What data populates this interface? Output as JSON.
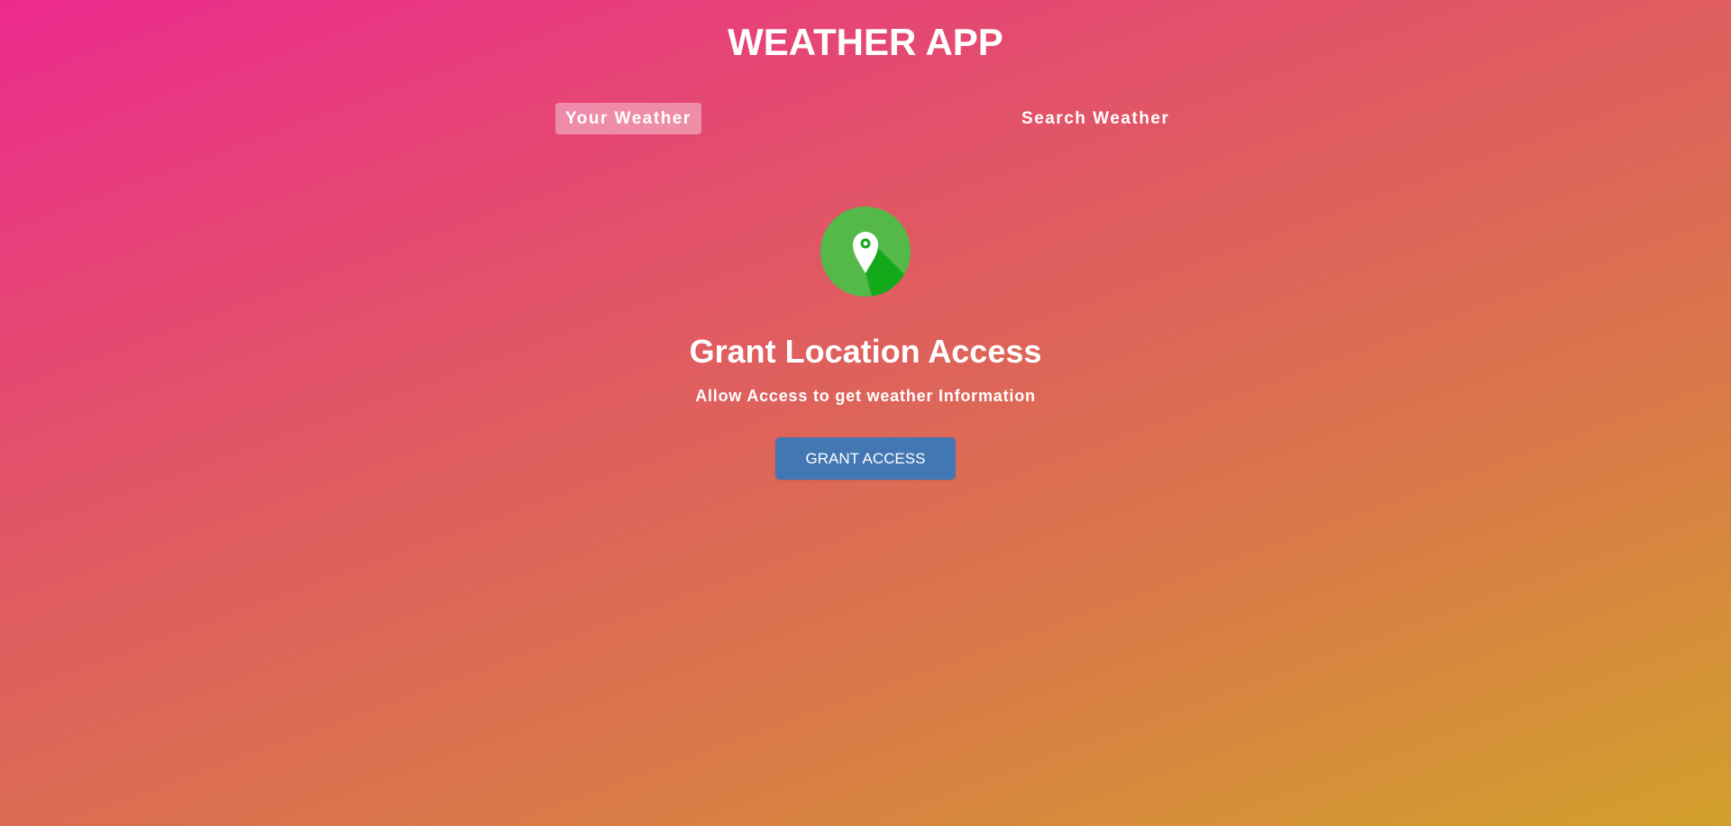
{
  "header": {
    "title": "WEATHER APP"
  },
  "tabs": [
    {
      "label": "Your Weather",
      "active": true
    },
    {
      "label": "Search Weather",
      "active": false
    }
  ],
  "grant_location": {
    "icon": "location-pin-icon",
    "icon_colors": {
      "circle": "#54b948",
      "shadow": "#14a81b",
      "pin": "#ffffff"
    },
    "title": "Grant Location Access",
    "subtitle": "Allow Access to get weather Information",
    "button_label": "GRANT ACCESS",
    "button_color": "#4277b4"
  }
}
